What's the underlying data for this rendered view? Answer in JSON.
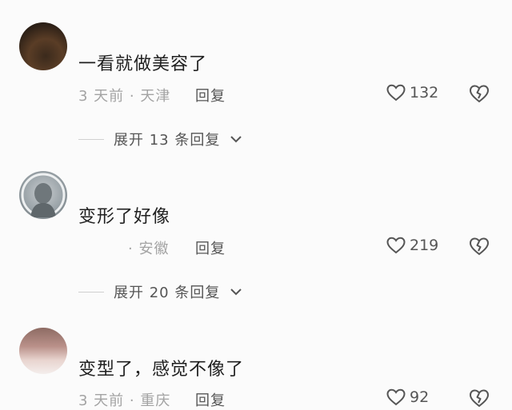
{
  "comments": [
    {
      "text": "一看就做美容了",
      "meta": "3 天前 · 天津",
      "reply_label": "回复",
      "likes": "132",
      "expand_label": "展开 13 条回复"
    },
    {
      "text": "变形了好像",
      "meta": "· 安徽",
      "reply_label": "回复",
      "likes": "219",
      "expand_label": "展开 20 条回复"
    },
    {
      "text": "变型了，感觉不像了",
      "meta": "3 天前 · 重庆",
      "reply_label": "回复",
      "likes": "92"
    }
  ],
  "icons": {
    "like": "heart-outline-icon",
    "dislike": "broken-heart-icon",
    "expand": "chevron-down-icon"
  },
  "colors": {
    "background": "#fbfbfb",
    "text": "#1f1f1f",
    "meta": "#a3a3a3",
    "action": "#555555"
  }
}
